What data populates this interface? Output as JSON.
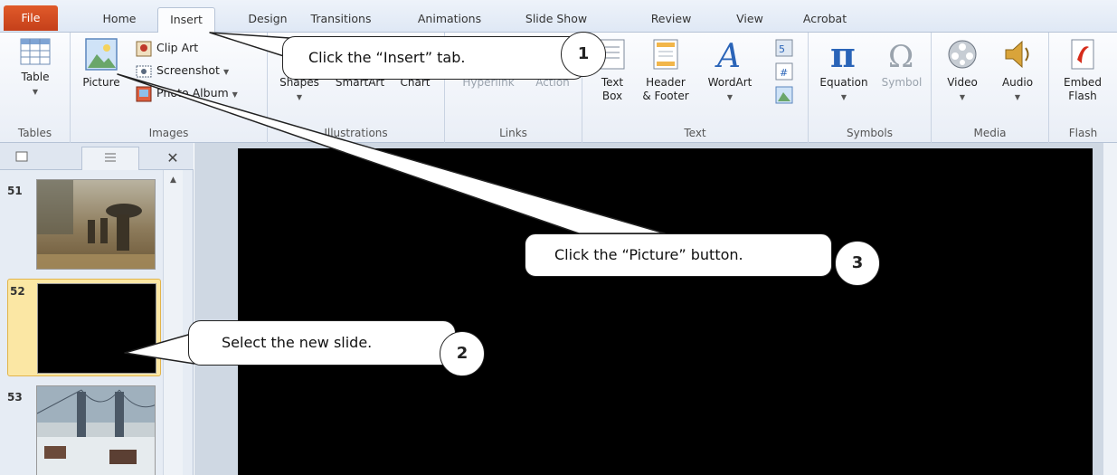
{
  "tabs": [
    {
      "label": "File"
    },
    {
      "label": "Home"
    },
    {
      "label": "Insert"
    },
    {
      "label": "Design"
    },
    {
      "label": "Transitions"
    },
    {
      "label": "Animations"
    },
    {
      "label": "Slide Show"
    },
    {
      "label": "Review"
    },
    {
      "label": "View"
    },
    {
      "label": "Acrobat"
    }
  ],
  "ribbon": {
    "tables": {
      "label": "Tables",
      "table": "Table"
    },
    "images": {
      "label": "Images",
      "picture": "Picture",
      "clip_art": "Clip Art",
      "screenshot": "Screenshot",
      "photo_album": "Photo Album"
    },
    "illustrations": {
      "label": "Illustrations",
      "shapes": "Shapes",
      "smartart": "SmartArt",
      "chart": "Chart"
    },
    "links": {
      "label": "Links",
      "hyperlink": "Hyperlink",
      "action": "Action"
    },
    "text": {
      "label": "Text",
      "text_box_1": "Text",
      "text_box_2": "Box",
      "header_1": "Header",
      "header_2": "& Footer",
      "wordart": "WordArt"
    },
    "symbols": {
      "label": "Symbols",
      "equation": "Equation",
      "symbol": "Symbol"
    },
    "media": {
      "label": "Media",
      "video": "Video",
      "audio": "Audio"
    },
    "flash": {
      "label": "Flash",
      "embed_1": "Embed",
      "embed_2": "Flash"
    }
  },
  "slides": [
    {
      "number": "51"
    },
    {
      "number": "52"
    },
    {
      "number": "53"
    }
  ],
  "callouts": {
    "one": {
      "text": "Click the “Insert” tab.",
      "badge": "1"
    },
    "two": {
      "text": "Select the new slide.",
      "badge": "2"
    },
    "three": {
      "text": "Click the “Picture” button.",
      "badge": "3"
    }
  }
}
